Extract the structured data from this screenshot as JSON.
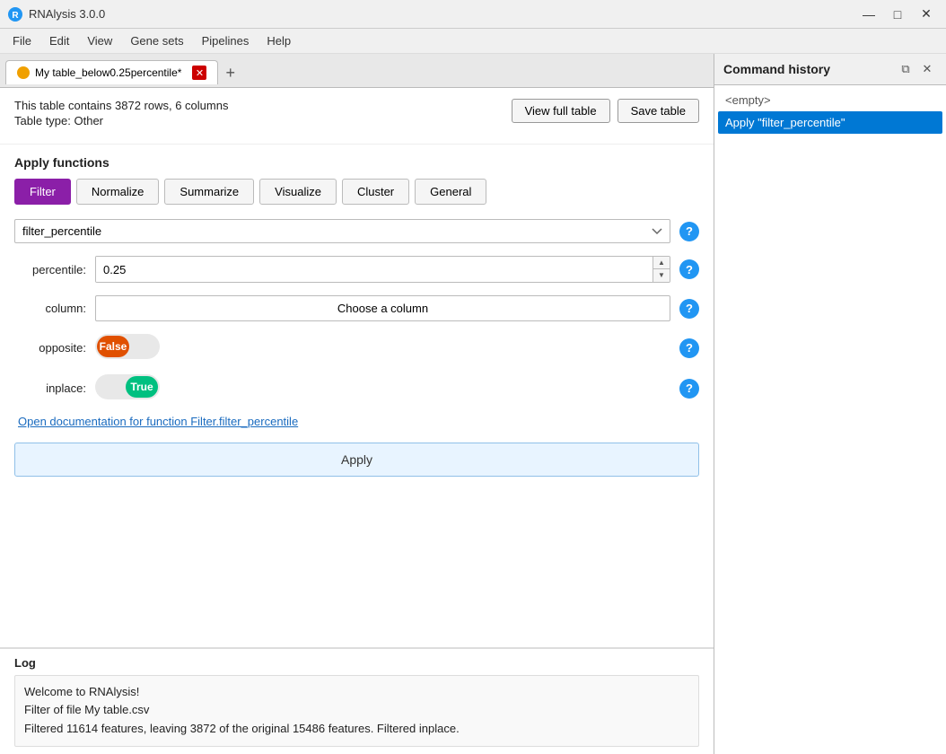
{
  "window": {
    "title": "RNAlysis 3.0.0",
    "minimize_label": "—",
    "maximize_label": "□",
    "close_label": "✕"
  },
  "menu": {
    "items": [
      "File",
      "Edit",
      "View",
      "Gene sets",
      "Pipelines",
      "Help"
    ]
  },
  "tab": {
    "name": "My table_below0.25percentile*",
    "icon_color": "#f0a000"
  },
  "table_info": {
    "rows_cols": "This table contains 3872 rows, 6 columns",
    "type": "Table type: Other",
    "view_full_label": "View full table",
    "save_label": "Save table"
  },
  "apply_functions": {
    "section_title": "Apply functions",
    "tabs": [
      "Filter",
      "Normalize",
      "Summarize",
      "Visualize",
      "Cluster",
      "General"
    ],
    "active_tab": "Filter"
  },
  "filter_form": {
    "function_value": "filter_percentile",
    "percentile_label": "percentile:",
    "percentile_value": "0.25",
    "column_label": "column:",
    "column_placeholder": "Choose a column",
    "opposite_label": "opposite:",
    "opposite_value": "False",
    "inplace_label": "inplace:",
    "inplace_value": "True",
    "doc_link": "Open documentation for function Filter.filter_percentile",
    "apply_label": "Apply"
  },
  "log": {
    "title": "Log",
    "lines": [
      "Welcome to RNAlysis!",
      "Filter of file My table.csv",
      "Filtered 11614 features, leaving 3872 of the original 15486 features. Filtered inplace."
    ]
  },
  "command_history": {
    "title": "Command history",
    "items": [
      {
        "label": "<empty>",
        "selected": false
      },
      {
        "label": "Apply \"filter_percentile\"",
        "selected": true
      }
    ],
    "restore_label": "⧉",
    "close_label": "✕"
  },
  "colors": {
    "active_tab_bg": "#8b1fa8",
    "help_btn_bg": "#2196F3",
    "apply_btn_bg": "#e8f4ff",
    "selected_cmd_bg": "#0078d4",
    "false_toggle_bg": "#e05000",
    "true_toggle_bg": "#00c080"
  }
}
